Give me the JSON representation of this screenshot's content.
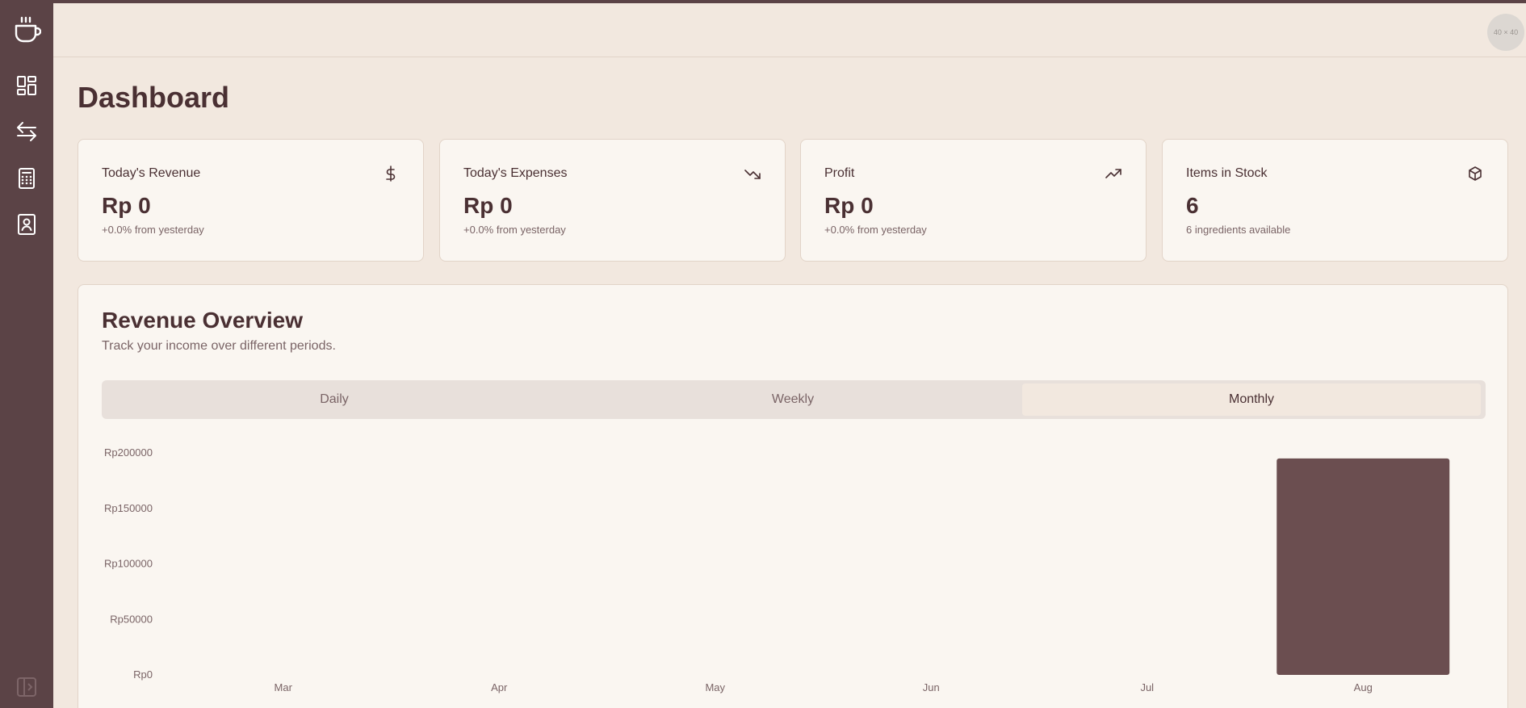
{
  "sidebar": {
    "logo_icon": "coffee-cup-icon",
    "items": [
      {
        "icon": "dashboard-grid-icon"
      },
      {
        "icon": "transactions-arrows-icon"
      },
      {
        "icon": "calculator-icon"
      },
      {
        "icon": "contacts-book-icon"
      }
    ],
    "collapse_icon": "sidebar-collapse-icon"
  },
  "header": {
    "avatar_text": "40 × 40"
  },
  "page": {
    "title": "Dashboard"
  },
  "cards": [
    {
      "title": "Today's Revenue",
      "value": "Rp 0",
      "sub": "+0.0% from yesterday",
      "icon": "dollar-icon"
    },
    {
      "title": "Today's Expenses",
      "value": "Rp 0",
      "sub": "+0.0% from yesterday",
      "icon": "trending-down-icon"
    },
    {
      "title": "Profit",
      "value": "Rp 0",
      "sub": "+0.0% from yesterday",
      "icon": "trending-up-icon"
    },
    {
      "title": "Items in Stock",
      "value": "6",
      "sub": "6 ingredients available",
      "icon": "package-icon"
    }
  ],
  "overview": {
    "title": "Revenue Overview",
    "description": "Track your income over different periods.",
    "tabs": [
      {
        "label": "Daily",
        "active": false
      },
      {
        "label": "Weekly",
        "active": false
      },
      {
        "label": "Monthly",
        "active": true
      }
    ]
  },
  "colors": {
    "sidebar": "#5b4346",
    "background": "#f2e8df",
    "card": "#faf6f1",
    "bar": "#6b4e50",
    "text": "#4a3033"
  },
  "chart_data": {
    "type": "bar",
    "categories": [
      "Mar",
      "Apr",
      "May",
      "Jun",
      "Jul",
      "Aug"
    ],
    "values": [
      0,
      0,
      0,
      0,
      0,
      195000
    ],
    "y_ticks": [
      "Rp0",
      "Rp50000",
      "Rp100000",
      "Rp150000",
      "Rp200000"
    ],
    "ylim": [
      0,
      200000
    ],
    "grid": false,
    "title": "",
    "xlabel": "",
    "ylabel": ""
  }
}
